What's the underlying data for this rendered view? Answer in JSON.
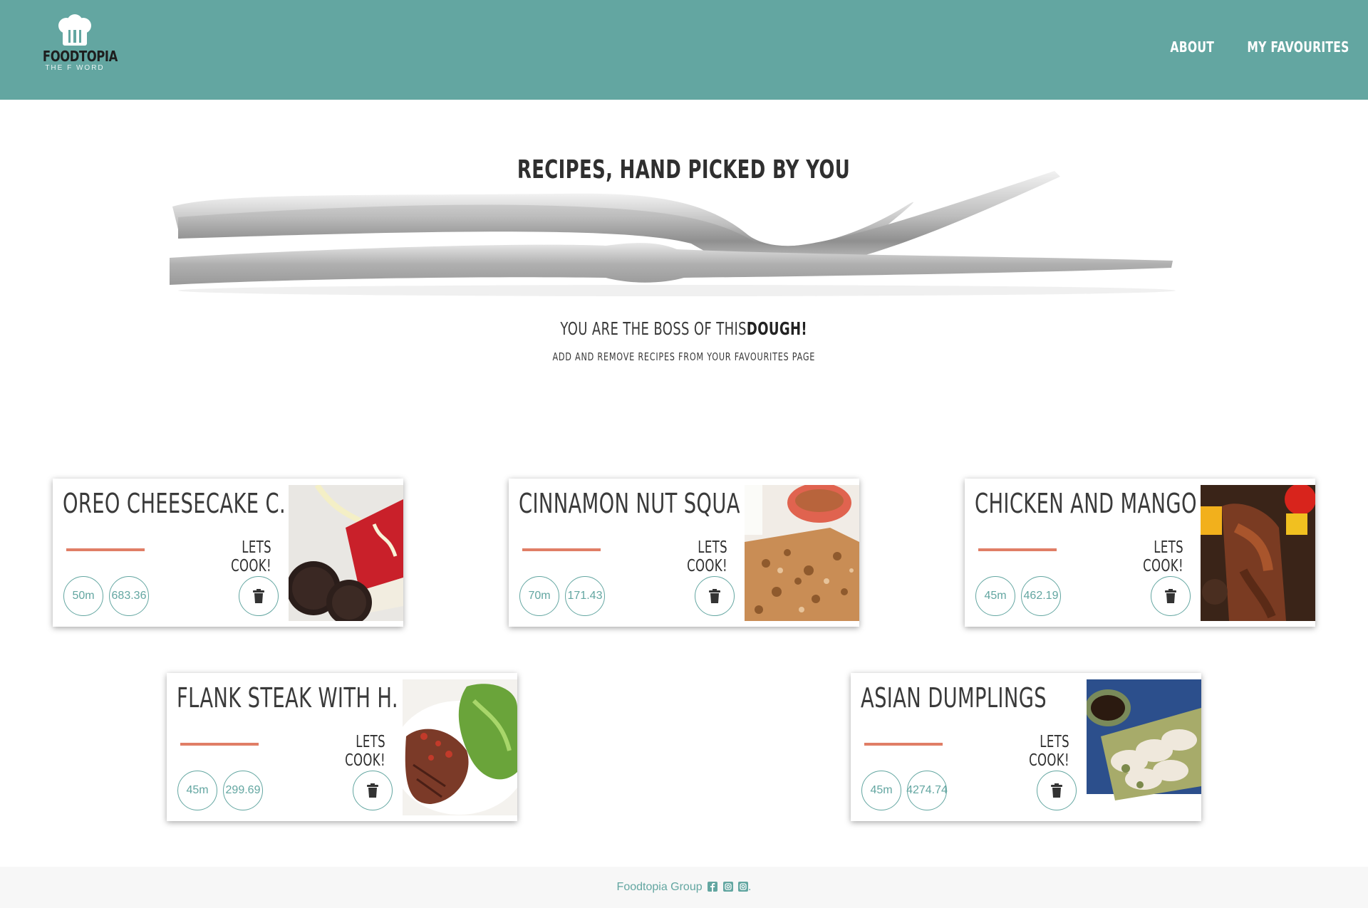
{
  "header": {
    "logo_title": "FOODTOPIA",
    "logo_subtitle": "THE F WORD",
    "nav": [
      {
        "label": "ABOUT"
      },
      {
        "label": "MY FAVOURITES"
      }
    ],
    "background_color": "#63a6a1"
  },
  "hero": {
    "title": "RECIPES, HAND PICKED BY YOU",
    "subtitle_prefix": "YOU ARE THE BOSS OF THIS ",
    "subtitle_emphasis": "DOUGH!",
    "note": "ADD AND REMOVE RECIPES FROM YOUR FAVOURITES PAGE"
  },
  "recipes": [
    {
      "title": "OREO CHEESECAKE C...",
      "cta": "LETS COOK!",
      "time": "50m",
      "calories": "683.36",
      "image": "oreo-cheesecake-photo"
    },
    {
      "title": "CINNAMON NUT SQUA...",
      "cta": "LETS COOK!",
      "time": "70m",
      "calories": "171.43",
      "image": "cinnamon-nut-squares-photo"
    },
    {
      "title": "CHICKEN AND MANGO...",
      "cta": "LETS COOK!",
      "time": "45m",
      "calories": "462.19",
      "image": "chicken-mango-skewers-photo"
    },
    {
      "title": "FLANK STEAK WITH H...",
      "cta": "LETS COOK!",
      "time": "45m",
      "calories": "299.69",
      "image": "flank-steak-salad-photo"
    },
    {
      "title": "ASIAN DUMPLINGS",
      "cta": "LETS COOK!",
      "time": "45m",
      "calories": "4274.74",
      "image": "asian-dumplings-photo"
    }
  ],
  "footer": {
    "text": "Foodtopia Group",
    "icons": [
      "facebook-icon",
      "instagram-icon",
      "instagram-icon"
    ],
    "suffix": "."
  },
  "colors": {
    "accent": "#63a6a1",
    "underline": "#e07e66",
    "text_dark": "#2f2f2f"
  }
}
